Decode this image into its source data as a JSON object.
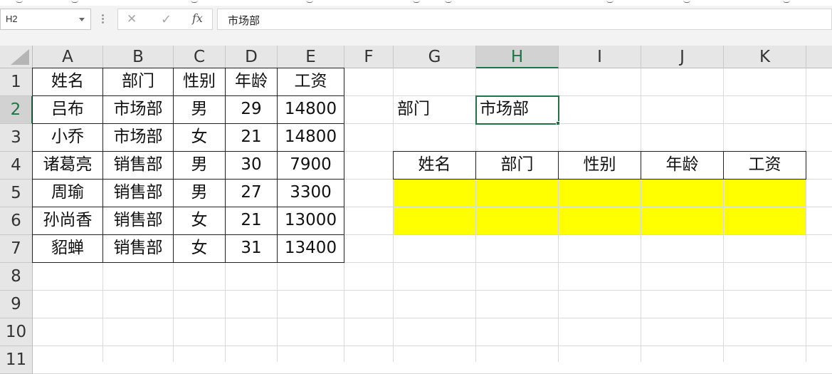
{
  "name_box": {
    "value": "H2"
  },
  "formula_bar": {
    "fx_label": "fx",
    "cancel_glyph": "✕",
    "enter_glyph": "✓",
    "content": "市场部"
  },
  "columns": [
    "A",
    "B",
    "C",
    "D",
    "E",
    "F",
    "G",
    "H",
    "I",
    "J",
    "K"
  ],
  "rows": [
    "1",
    "2",
    "3",
    "4",
    "5",
    "6",
    "7",
    "8",
    "9",
    "10",
    "11"
  ],
  "selected_cell": "H2",
  "source_table": {
    "headers": [
      "姓名",
      "部门",
      "性别",
      "年龄",
      "工资"
    ],
    "records": [
      [
        "吕布",
        "市场部",
        "男",
        "29",
        "14800"
      ],
      [
        "小乔",
        "市场部",
        "女",
        "21",
        "14800"
      ],
      [
        "诸葛亮",
        "销售部",
        "男",
        "30",
        "7900"
      ],
      [
        "周瑜",
        "销售部",
        "男",
        "27",
        "3300"
      ],
      [
        "孙尚香",
        "销售部",
        "女",
        "21",
        "13000"
      ],
      [
        "貂蝉",
        "销售部",
        "女",
        "31",
        "13400"
      ]
    ]
  },
  "criteria": {
    "label": "部门",
    "value": "市场部"
  },
  "result_table": {
    "headers": [
      "姓名",
      "部门",
      "性别",
      "年龄",
      "工资"
    ],
    "fill_color": "#ffff00"
  },
  "colors": {
    "accent_green": "#217346",
    "header_gray": "#e6e6e6"
  }
}
